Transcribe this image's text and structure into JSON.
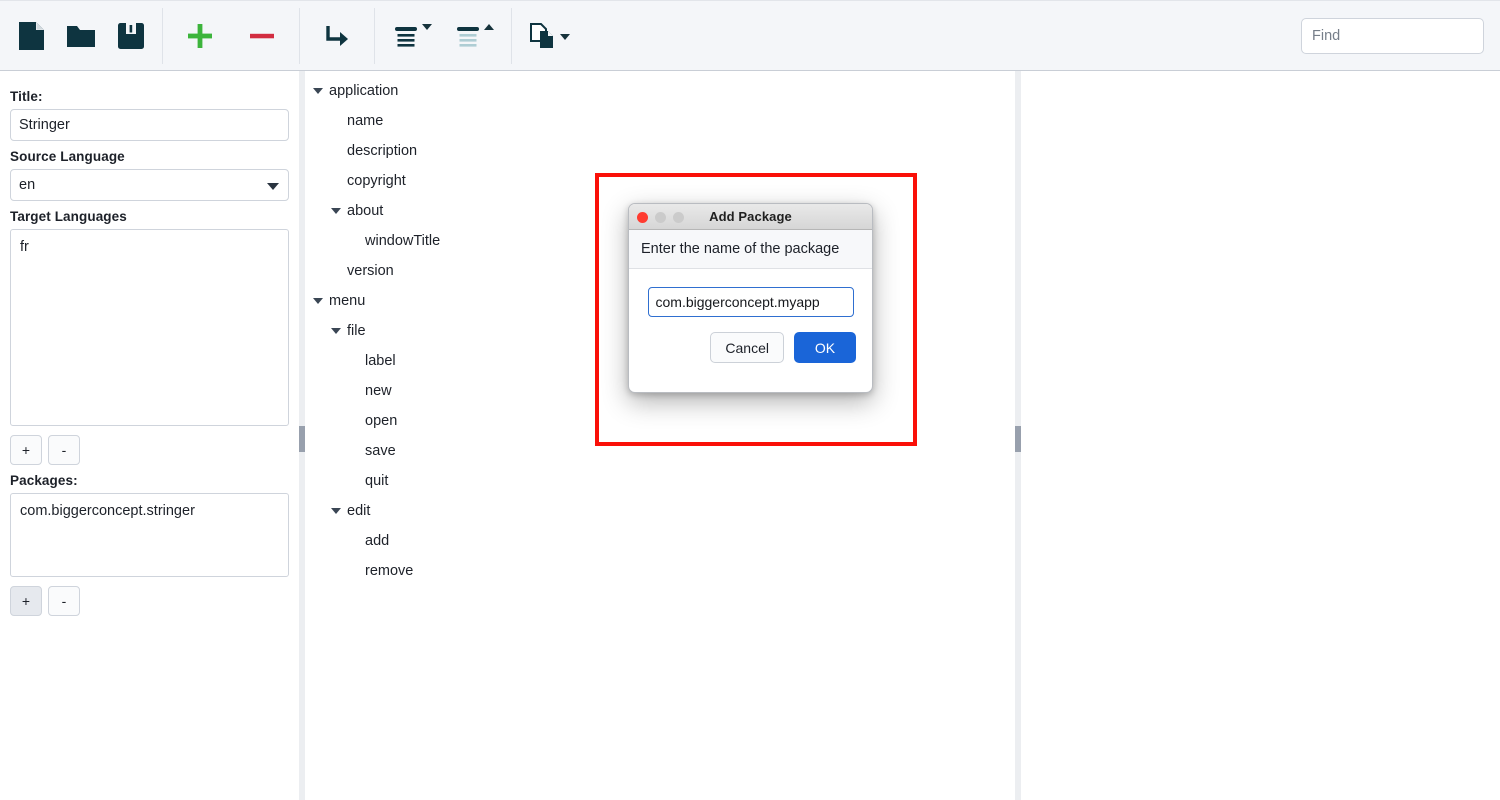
{
  "toolbar": {
    "buttons": [
      {
        "name": "new-file-button",
        "icon": "new-file-icon",
        "tooltip": "New"
      },
      {
        "name": "open-folder-button",
        "icon": "open-folder-icon",
        "tooltip": "Open"
      },
      {
        "name": "save-button",
        "icon": "floppy-save-icon",
        "tooltip": "Save"
      },
      {
        "name": "add-key-button",
        "icon": "plus-icon",
        "tooltip": "Add"
      },
      {
        "name": "remove-key-button",
        "icon": "minus-icon",
        "tooltip": "Remove"
      },
      {
        "name": "add-child-button",
        "icon": "arrow-turn-right-icon",
        "tooltip": "Add Child"
      },
      {
        "name": "expand-all-button",
        "icon": "expand-all-icon",
        "tooltip": "Expand All"
      },
      {
        "name": "collapse-all-button",
        "icon": "collapse-all-icon",
        "tooltip": "Collapse All"
      },
      {
        "name": "duplicate-button",
        "icon": "copy-documents-icon",
        "tooltip": "Duplicate"
      }
    ],
    "colors": {
      "icon": "#0e3440",
      "plus": "#3cb43c",
      "minus": "#d22d41",
      "collapse_light": "#aecdd4"
    }
  },
  "find": {
    "value": "",
    "placeholder": "Find"
  },
  "sidebar": {
    "title_label": "Title:",
    "title_value": "Stringer",
    "source_language_label": "Source Language",
    "source_language_value": "en",
    "target_languages_label": "Target Languages",
    "target_languages": [
      "fr"
    ],
    "target_add_label": "+",
    "target_remove_label": "-",
    "packages_label": "Packages:",
    "packages": [
      "com.biggerconcept.stringer"
    ],
    "packages_add_label": "+",
    "packages_remove_label": "-"
  },
  "tree": {
    "nodes": [
      {
        "label": "application",
        "depth": 0,
        "expanded": true
      },
      {
        "label": "name",
        "depth": 1,
        "expanded": null
      },
      {
        "label": "description",
        "depth": 1,
        "expanded": null
      },
      {
        "label": "copyright",
        "depth": 1,
        "expanded": null
      },
      {
        "label": "about",
        "depth": 1,
        "expanded": true
      },
      {
        "label": "windowTitle",
        "depth": 2,
        "expanded": null
      },
      {
        "label": "version",
        "depth": 1,
        "expanded": null
      },
      {
        "label": "menu",
        "depth": 0,
        "expanded": true
      },
      {
        "label": "file",
        "depth": 1,
        "expanded": true
      },
      {
        "label": "label",
        "depth": 2,
        "expanded": null
      },
      {
        "label": "new",
        "depth": 2,
        "expanded": null
      },
      {
        "label": "open",
        "depth": 2,
        "expanded": null
      },
      {
        "label": "save",
        "depth": 2,
        "expanded": null
      },
      {
        "label": "quit",
        "depth": 2,
        "expanded": null
      },
      {
        "label": "edit",
        "depth": 1,
        "expanded": true
      },
      {
        "label": "add",
        "depth": 2,
        "expanded": null
      },
      {
        "label": "remove",
        "depth": 2,
        "expanded": null
      }
    ]
  },
  "dialog": {
    "title": "Add Package",
    "prompt": "Enter the name of the package",
    "input_value": "com.biggerconcept.myapp",
    "input_placeholder": "",
    "cancel_label": "Cancel",
    "ok_label": "OK",
    "accent_color": "#1a65d8",
    "close_dot_color": "#ff3b30"
  },
  "highlight": {
    "color": "#fa1008"
  }
}
